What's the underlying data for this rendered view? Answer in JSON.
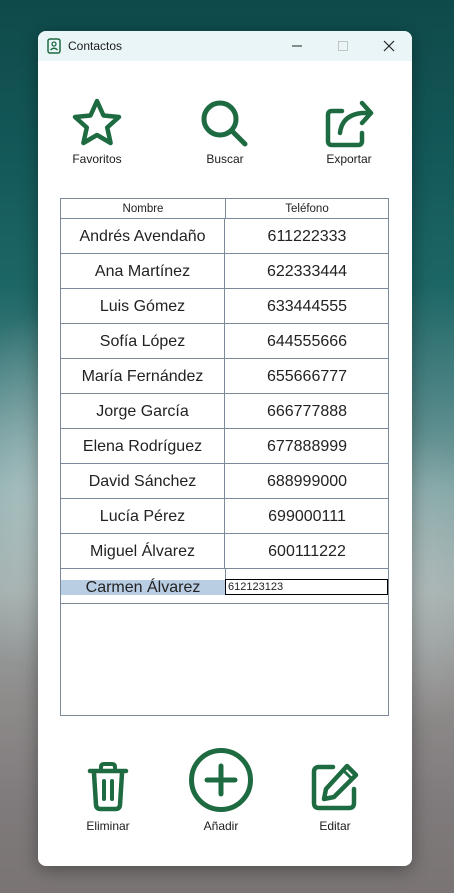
{
  "window": {
    "title": "Contactos",
    "icon": "contact-book-icon",
    "controls": [
      "minimize-icon",
      "maximize-icon",
      "close-icon"
    ]
  },
  "toolbar": {
    "favorites_label": "Favoritos",
    "search_label": "Buscar",
    "export_label": "Exportar"
  },
  "table": {
    "columns": [
      "Nombre",
      "Teléfono"
    ],
    "rows": [
      {
        "name": "Andrés Avendaño",
        "phone": "611222333"
      },
      {
        "name": "Ana Martínez",
        "phone": "622333444"
      },
      {
        "name": "Luis Gómez",
        "phone": "633444555"
      },
      {
        "name": "Sofía López",
        "phone": "644555666"
      },
      {
        "name": "María Fernández",
        "phone": "655666777"
      },
      {
        "name": "Jorge García",
        "phone": "666777888"
      },
      {
        "name": "Elena Rodríguez",
        "phone": "677888999"
      },
      {
        "name": "David Sánchez",
        "phone": "688999000"
      },
      {
        "name": "Lucía Pérez",
        "phone": "699000111"
      },
      {
        "name": "Miguel Álvarez",
        "phone": "600111222"
      }
    ],
    "editing_row": {
      "name": "Carmen Álvarez",
      "phone": "612123123"
    }
  },
  "actions": {
    "delete_label": "Eliminar",
    "add_label": "Añadir",
    "edit_label": "Editar"
  },
  "colors": {
    "accent": "#1e6b42",
    "selection": "#b9cde3",
    "titlebar": "#e9f5f7"
  }
}
